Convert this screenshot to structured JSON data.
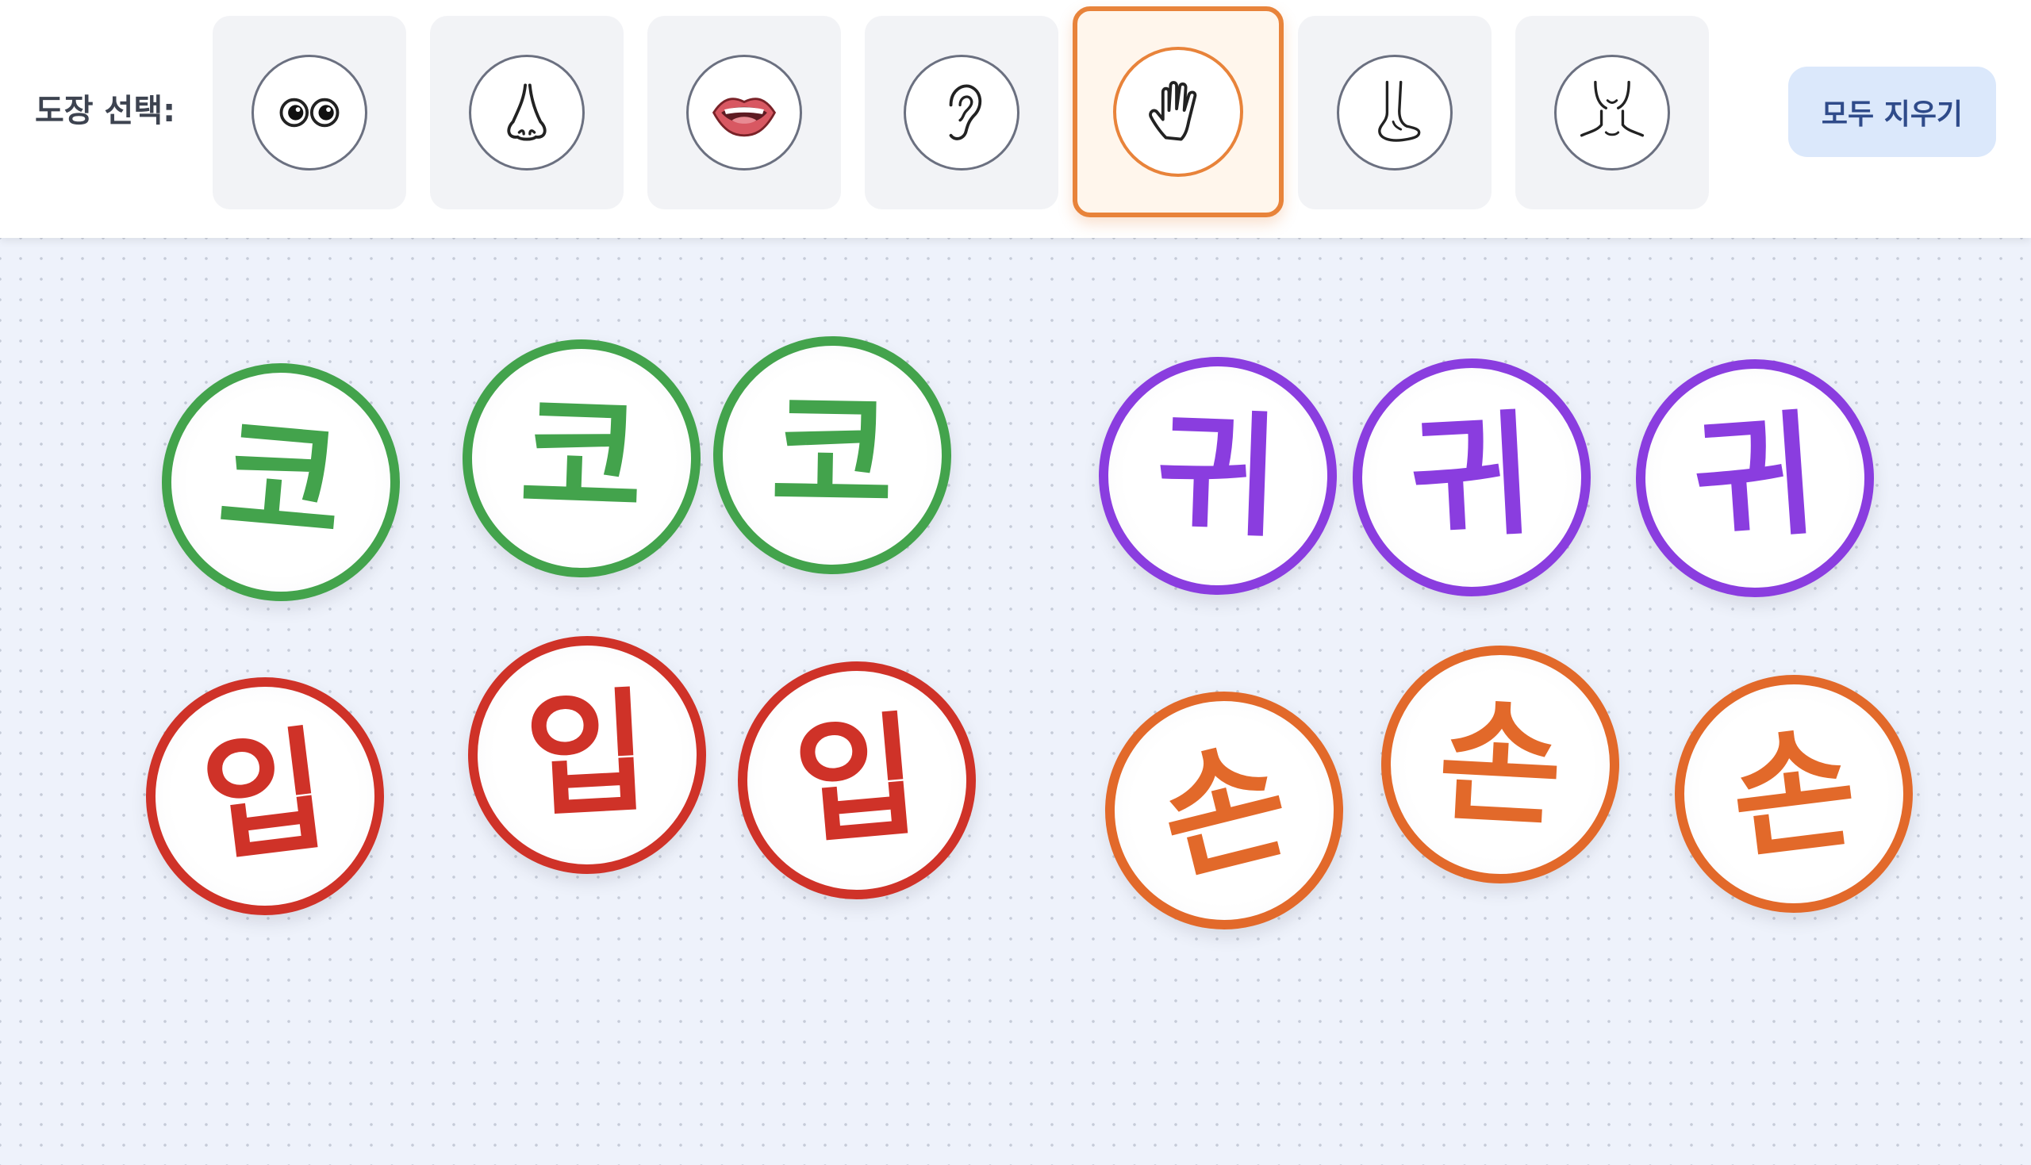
{
  "toolbar": {
    "label": "도장 선택:",
    "tools": [
      {
        "icon": "eyes-icon",
        "selected": false
      },
      {
        "icon": "nose-icon",
        "selected": false
      },
      {
        "icon": "mouth-icon",
        "selected": false
      },
      {
        "icon": "ear-icon",
        "selected": false
      },
      {
        "icon": "hand-icon",
        "selected": true
      },
      {
        "icon": "foot-icon",
        "selected": false
      },
      {
        "icon": "neck-icon",
        "selected": false
      }
    ],
    "clear_label": "모두 지우기"
  },
  "colors": {
    "selected_accent": "#e8833a",
    "nose": "#43a34c",
    "ear": "#8a3ddf",
    "mouth": "#cf3228",
    "hand": "#e2692a"
  },
  "stamps": [
    {
      "text": "코",
      "color": "#43a34c",
      "rotation": 5
    },
    {
      "text": "코",
      "color": "#43a34c",
      "rotation": 2
    },
    {
      "text": "코",
      "color": "#43a34c",
      "rotation": 1
    },
    {
      "text": "귀",
      "color": "#8a3ddf",
      "rotation": 2
    },
    {
      "text": "귀",
      "color": "#8a3ddf",
      "rotation": -3
    },
    {
      "text": "귀",
      "color": "#8a3ddf",
      "rotation": -4
    },
    {
      "text": "입",
      "color": "#cf3228",
      "rotation": -7
    },
    {
      "text": "입",
      "color": "#cf3228",
      "rotation": -3
    },
    {
      "text": "입",
      "color": "#cf3228",
      "rotation": -5
    },
    {
      "text": "손",
      "color": "#e2692a",
      "rotation": -14
    },
    {
      "text": "손",
      "color": "#e2692a",
      "rotation": 3
    },
    {
      "text": "손",
      "color": "#e2692a",
      "rotation": -7
    }
  ]
}
